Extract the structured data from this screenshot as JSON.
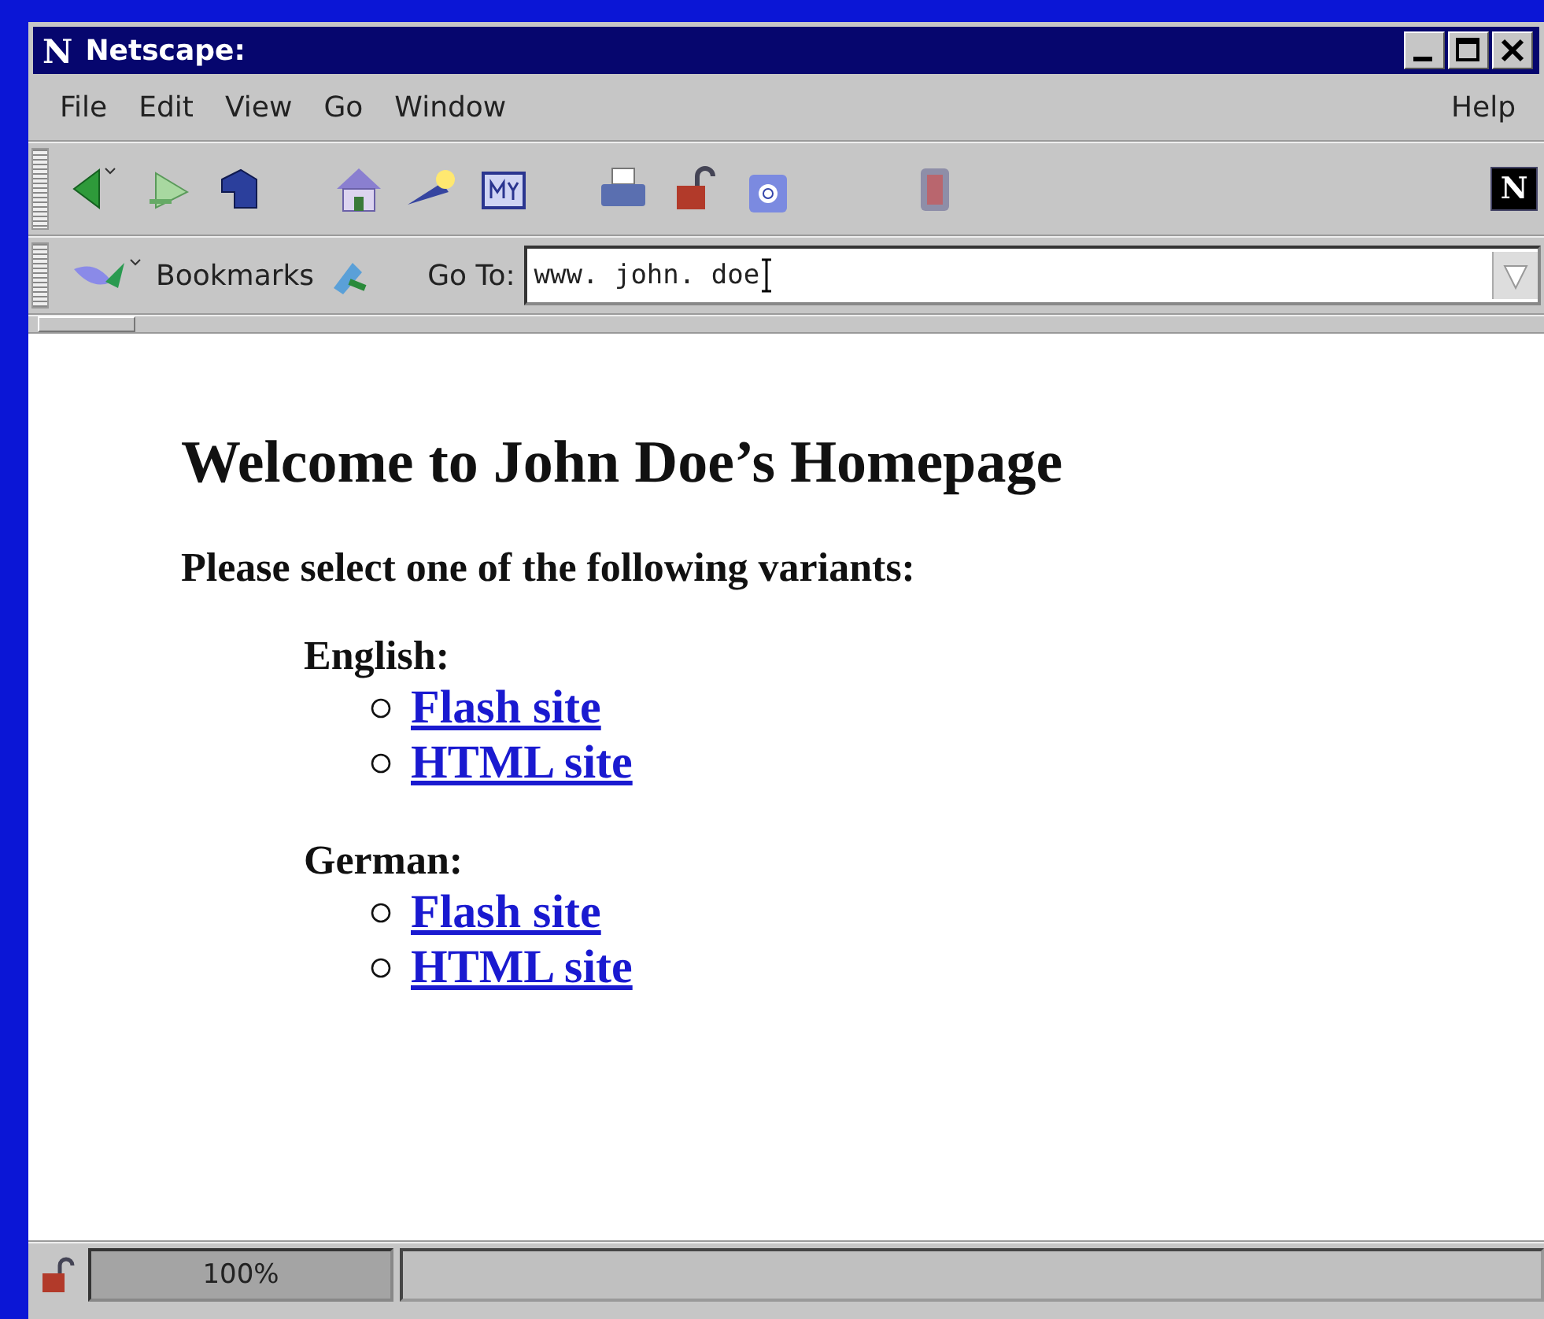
{
  "window": {
    "logo": "N",
    "title": "Netscape:"
  },
  "menu": [
    {
      "label": "File"
    },
    {
      "label": "Edit"
    },
    {
      "label": "View"
    },
    {
      "label": "Go"
    },
    {
      "label": "Window"
    },
    {
      "label": "Help"
    }
  ],
  "toolbar": {
    "throbber": "N"
  },
  "location_bar": {
    "bookmarks": "Bookmarks",
    "goto_label": "Go To:",
    "value": "www. john. doe"
  },
  "page": {
    "heading": "Welcome to John Doe’s Homepage",
    "subheading": "Please select one of the following variants:",
    "groups": [
      {
        "label": "English:",
        "links": [
          "Flash site",
          "HTML site"
        ]
      },
      {
        "label": "German:",
        "links": [
          "Flash site",
          "HTML site"
        ]
      }
    ]
  },
  "status_bar": {
    "progress": "100%"
  }
}
